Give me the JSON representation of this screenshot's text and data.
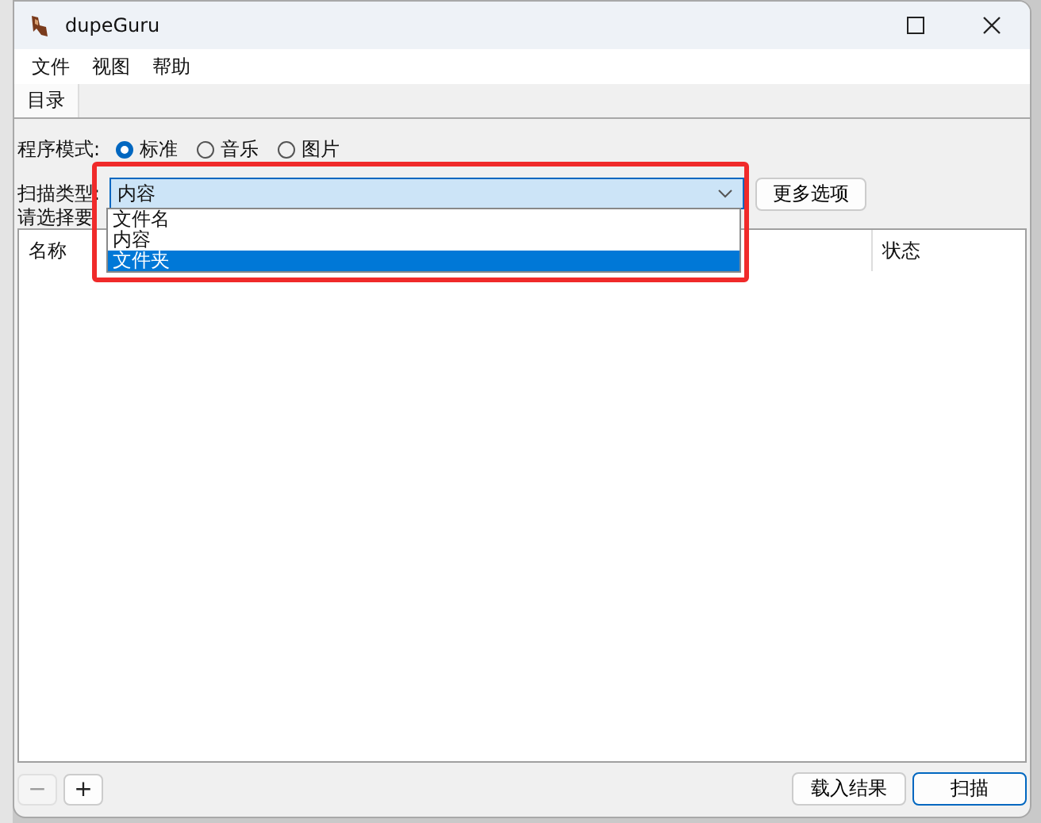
{
  "window": {
    "title": "dupeGuru"
  },
  "menu": [
    "文件",
    "视图",
    "帮助"
  ],
  "tabs": [
    {
      "label": "目录",
      "selected": true
    }
  ],
  "mode": {
    "label": "程序模式:",
    "options": [
      {
        "label": "标准",
        "selected": true
      },
      {
        "label": "音乐",
        "selected": false
      },
      {
        "label": "图片",
        "selected": false
      }
    ]
  },
  "scan_type": {
    "label": "扫描类型:",
    "value": "内容",
    "open": true,
    "options": [
      {
        "label": "文件名",
        "highlighted": false
      },
      {
        "label": "内容",
        "highlighted": false
      },
      {
        "label": "文件夹",
        "highlighted": true
      }
    ]
  },
  "more_options_button": "更多选项",
  "hint": "请选择要",
  "table": {
    "columns": [
      "名称",
      "状态"
    ]
  },
  "buttons": [
    {
      "label": "载入结果",
      "default": false
    },
    {
      "label": "扫描",
      "default": true
    }
  ],
  "folder_buttons": [
    {
      "label": "−",
      "disabled": true
    },
    {
      "label": "+",
      "disabled": false
    }
  ]
}
